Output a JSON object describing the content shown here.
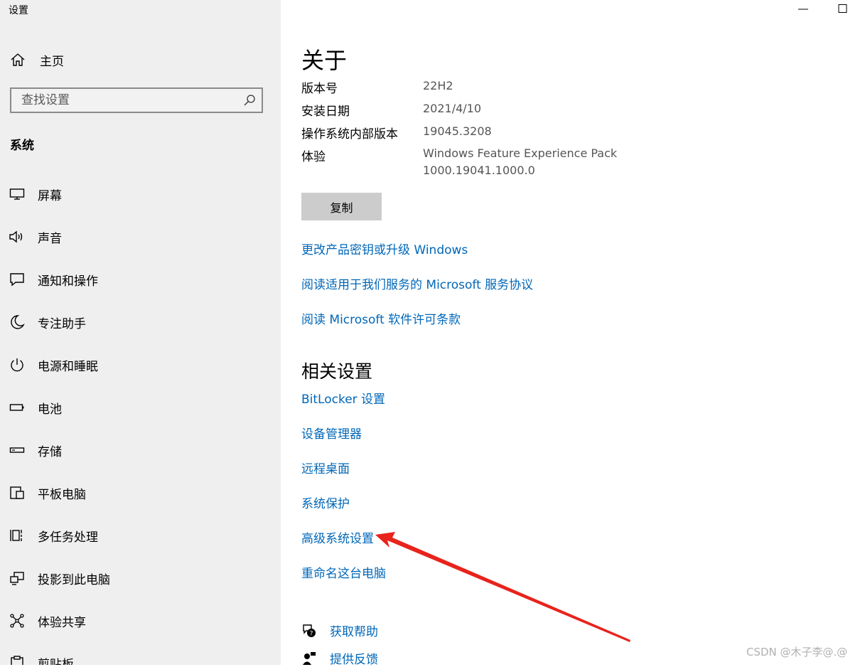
{
  "window": {
    "title": "设置"
  },
  "sidebar": {
    "home_label": "主页",
    "search_placeholder": "查找设置",
    "section": "系统",
    "items": [
      {
        "label": "屏幕",
        "icon": "monitor-icon"
      },
      {
        "label": "声音",
        "icon": "speaker-icon"
      },
      {
        "label": "通知和操作",
        "icon": "notification-icon"
      },
      {
        "label": "专注助手",
        "icon": "moon-icon"
      },
      {
        "label": "电源和睡眠",
        "icon": "power-icon"
      },
      {
        "label": "电池",
        "icon": "battery-icon"
      },
      {
        "label": "存储",
        "icon": "storage-icon"
      },
      {
        "label": "平板电脑",
        "icon": "tablet-icon"
      },
      {
        "label": "多任务处理",
        "icon": "multitasking-icon"
      },
      {
        "label": "投影到此电脑",
        "icon": "projection-icon"
      },
      {
        "label": "体验共享",
        "icon": "share-icon"
      },
      {
        "label": "剪贴板",
        "icon": "clipboard-icon"
      }
    ]
  },
  "main": {
    "title": "关于",
    "info": [
      {
        "label": "版本号",
        "value": "22H2"
      },
      {
        "label": "安装日期",
        "value": "2021/4/10"
      },
      {
        "label": "操作系统内部版本",
        "value": "19045.3208"
      },
      {
        "label": "体验",
        "value": "Windows Feature Experience Pack",
        "value2": "1000.19041.1000.0"
      }
    ],
    "copy_button": "复制",
    "links": [
      "更改产品密钥或升级 Windows",
      "阅读适用于我们服务的 Microsoft 服务协议",
      "阅读 Microsoft 软件许可条款"
    ],
    "related_title": "相关设置",
    "related_links": [
      "BitLocker 设置",
      "设备管理器",
      "远程桌面",
      "系统保护",
      "高级系统设置",
      "重命名这台电脑"
    ],
    "help_links": [
      {
        "label": "获取帮助",
        "icon": "help-chat-icon"
      },
      {
        "label": "提供反馈",
        "icon": "feedback-icon"
      }
    ]
  },
  "watermark": "CSDN @木子李@.@",
  "colors": {
    "link": "#0067b8",
    "sidebar_bg": "#efefef",
    "annotation_arrow": "#e8231c"
  }
}
